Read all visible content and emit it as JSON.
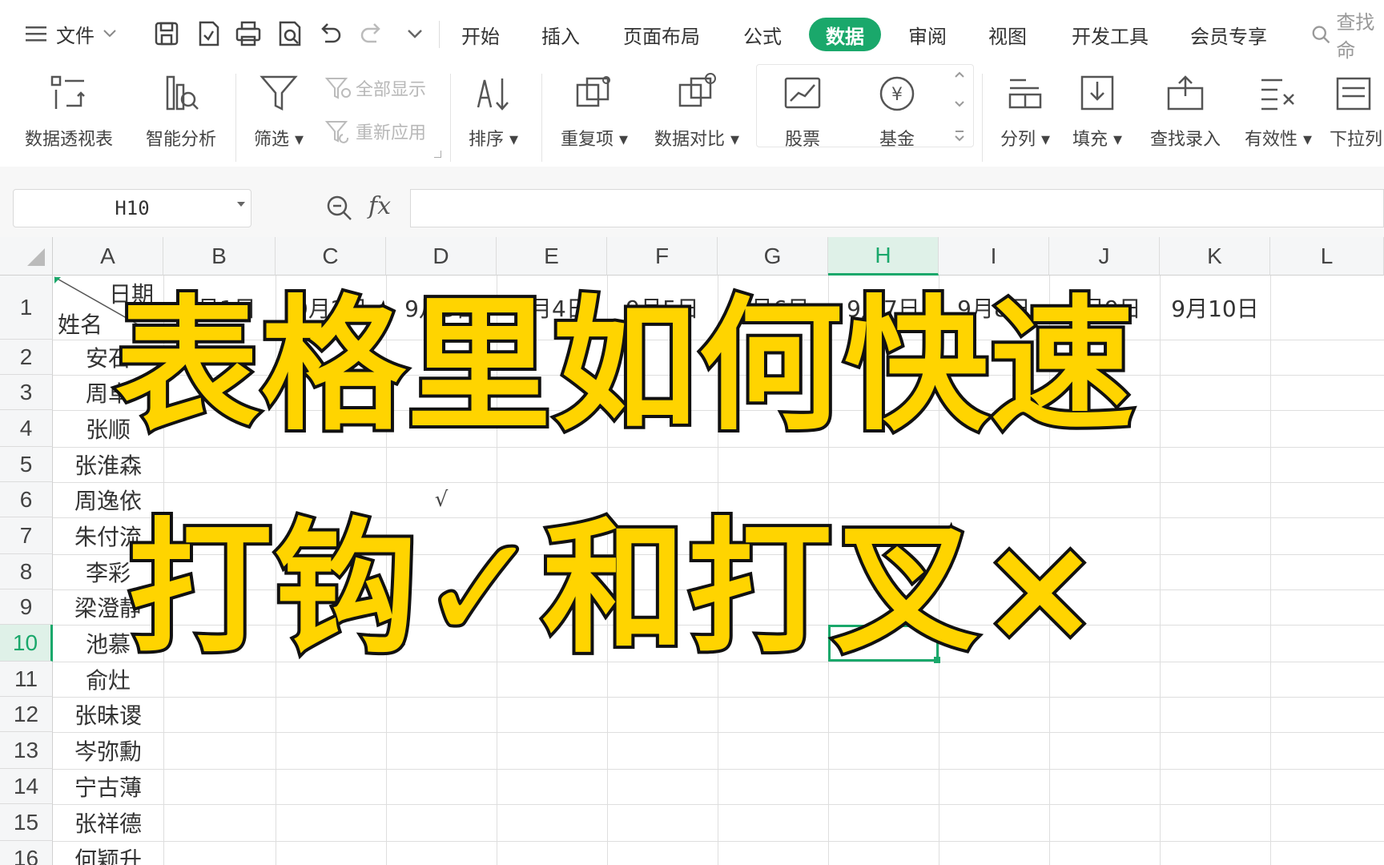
{
  "menubar": {
    "file_label": "文件",
    "tabs": [
      {
        "label": "开始",
        "active": false
      },
      {
        "label": "插入",
        "active": false
      },
      {
        "label": "页面布局",
        "active": false
      },
      {
        "label": "公式",
        "active": false
      },
      {
        "label": "数据",
        "active": true
      },
      {
        "label": "审阅",
        "active": false
      },
      {
        "label": "视图",
        "active": false
      },
      {
        "label": "开发工具",
        "active": false
      },
      {
        "label": "会员专享",
        "active": false
      }
    ],
    "search_label": "查找命"
  },
  "ribbon": {
    "pivot": "数据透视表",
    "smart": "智能分析",
    "filter": "筛选",
    "show_all": "全部显示",
    "reapply": "重新应用",
    "sort": "排序",
    "duplicates": "重复项",
    "compare": "数据对比",
    "stock": "股票",
    "fund": "基金",
    "split": "分列",
    "fill": "填充",
    "lookup": "查找录入",
    "validity": "有效性",
    "dropdown": "下拉列"
  },
  "formula": {
    "namebox": "H10",
    "fx": "fx",
    "value": ""
  },
  "grid": {
    "columns": [
      "A",
      "B",
      "C",
      "D",
      "E",
      "F",
      "G",
      "H",
      "I",
      "J",
      "K",
      "L"
    ],
    "selected_column": "H",
    "rows": [
      "1",
      "2",
      "3",
      "4",
      "5",
      "6",
      "7",
      "8",
      "9",
      "10",
      "11",
      "12",
      "13",
      "14",
      "15",
      "16"
    ],
    "selected_row": "10",
    "header_date": "日期",
    "header_name": "姓名",
    "dates": [
      "9月1日",
      "9月2日",
      "9月3日",
      "9月4日",
      "9月5日",
      "9月6日",
      "9月7日",
      "9月8日",
      "9月9日",
      "9月10日"
    ],
    "names": [
      "安石",
      "周卓",
      "张顺",
      "张淮森",
      "周逸依",
      "朱付流",
      "李彩",
      "梁澄静",
      "池慕",
      "俞灶",
      "张昧谡",
      "岑弥勳",
      "宁古薄",
      "张祥德",
      "何颖升"
    ],
    "d6_mark": "√"
  },
  "overlay": {
    "line1": "表格里如何快速",
    "line2": "打钩✓和打叉×"
  },
  "colors": {
    "accent": "#1aa86b",
    "overlay_fill": "#ffd400",
    "overlay_stroke": "#111111"
  }
}
